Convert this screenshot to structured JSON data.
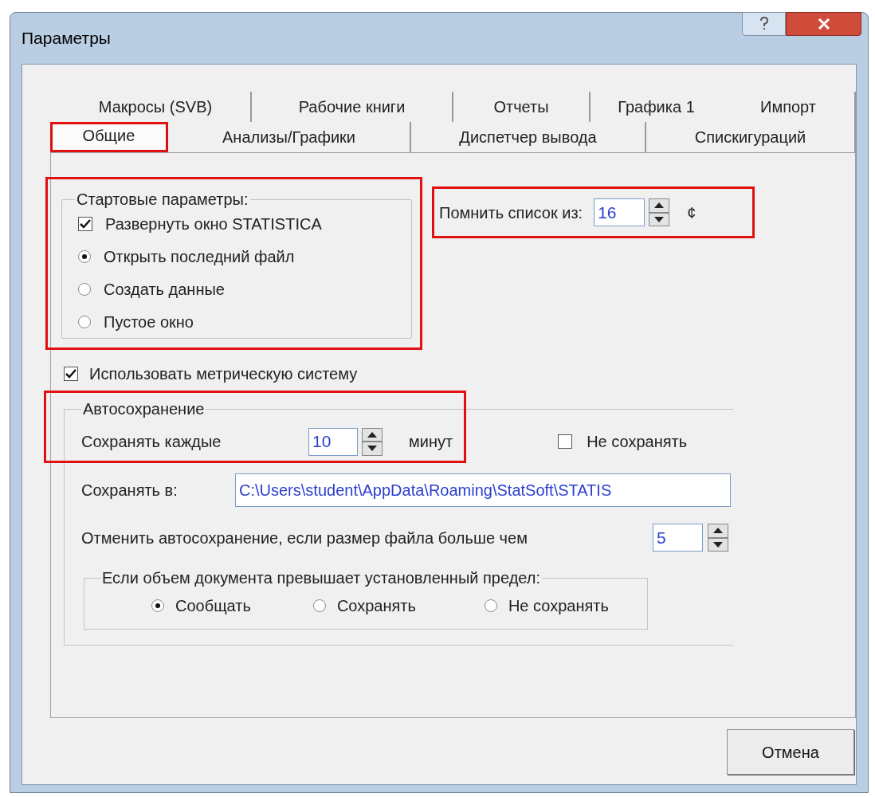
{
  "window": {
    "title": "Параметры"
  },
  "tab_rows": [
    [
      {
        "label": "Макросы (SVB)",
        "selected": false,
        "highlighted": false
      },
      {
        "label": "Рабочие книги",
        "selected": false,
        "highlighted": false
      },
      {
        "label": "Отчеты",
        "selected": false,
        "highlighted": false
      },
      {
        "label": "Графика 1",
        "selected": false,
        "highlighted": false
      },
      {
        "label": "Импорт",
        "selected": false,
        "highlighted": false
      }
    ],
    [
      {
        "label": "Общие",
        "selected": true,
        "highlighted": true
      },
      {
        "label": "Анализы/Графики",
        "selected": false,
        "highlighted": false
      },
      {
        "label": "Диспетчер вывода",
        "selected": false,
        "highlighted": false
      },
      {
        "label": "Спискигураций",
        "selected": false,
        "highlighted": false
      }
    ]
  ],
  "startup_group": {
    "title": "Стартовые параметры:",
    "highlighted": true,
    "options": [
      {
        "kind": "checkbox",
        "label": "Развернуть окно STATISTICA",
        "checked": true
      },
      {
        "kind": "radio",
        "label": "Открыть последний файл",
        "selected": true
      },
      {
        "kind": "radio",
        "label": "Создать данные",
        "selected": false
      },
      {
        "kind": "radio",
        "label": "Пустое окно",
        "selected": false
      }
    ]
  },
  "recent_files": {
    "label": "Помнить список из:",
    "value": "16",
    "suffix": "¢",
    "highlighted": true
  },
  "metric": {
    "label": "Использовать метрическую систему",
    "checked": true
  },
  "autosave": {
    "title": "Автосохранение",
    "highlighted": true,
    "interval": {
      "label": "Сохранять каждые",
      "value": "10",
      "unit": "минут"
    },
    "disable": {
      "label": "Не сохранять",
      "checked": false
    },
    "path": {
      "label": "Сохранять в:",
      "value": "C:\\Users\\student\\AppData\\Roaming\\StatSoft\\STATIS"
    },
    "size_limit": {
      "label": "Отменить автосохранение, если размер файла больше чем",
      "value": "5"
    },
    "limit_group": {
      "title": "Если объем документа превышает установленный предел:",
      "options": [
        {
          "label": "Сообщать",
          "selected": true
        },
        {
          "label": "Сохранять",
          "selected": false
        },
        {
          "label": "Не сохранять",
          "selected": false
        }
      ]
    }
  },
  "buttons": [
    "Отмена"
  ]
}
